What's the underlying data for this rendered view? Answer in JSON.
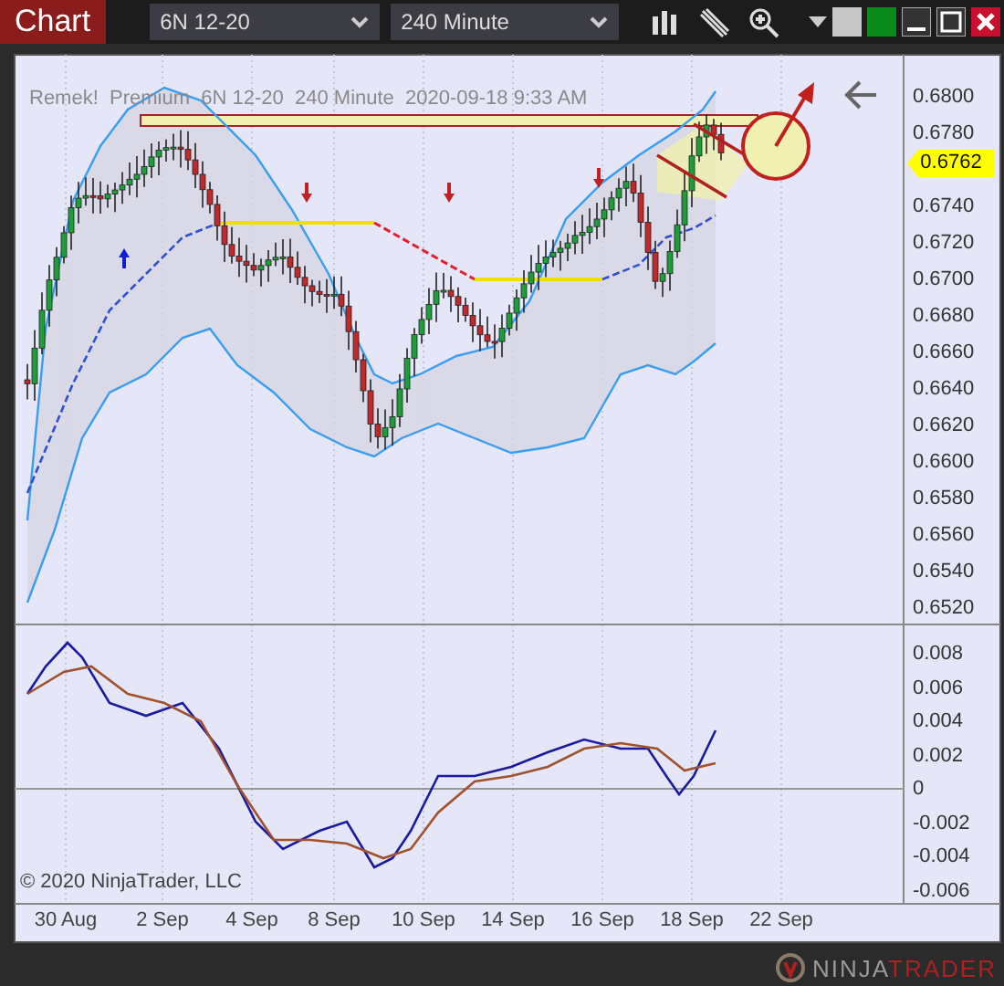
{
  "toolbar": {
    "title": "Chart",
    "instrument": "6N 12-20",
    "interval": "240 Minute"
  },
  "chart": {
    "label": "Remek!  Premium  6N 12-20  240 Minute  2020-09-18 9:33 AM",
    "price_ticks": [
      "0.6800",
      "0.6780",
      "0.6740",
      "0.6720",
      "0.6700",
      "0.6680",
      "0.6660",
      "0.6640",
      "0.6620",
      "0.6600",
      "0.6580",
      "0.6560",
      "0.6540",
      "0.6520"
    ],
    "last_price": "0.6762",
    "oscillator_ticks": [
      "0.008",
      "0.006",
      "0.004",
      "0.002",
      "0",
      "-0.002",
      "-0.004",
      "-0.006"
    ],
    "dates": [
      "30 Aug",
      "2 Sep",
      "4 Sep",
      "8 Sep",
      "10 Sep",
      "14 Sep",
      "16 Sep",
      "18 Sep",
      "22 Sep"
    ],
    "copyright": "© 2020 NinjaTrader, LLC"
  },
  "footer": {
    "logo_1": "NINJA",
    "logo_2": "TRADER"
  }
}
